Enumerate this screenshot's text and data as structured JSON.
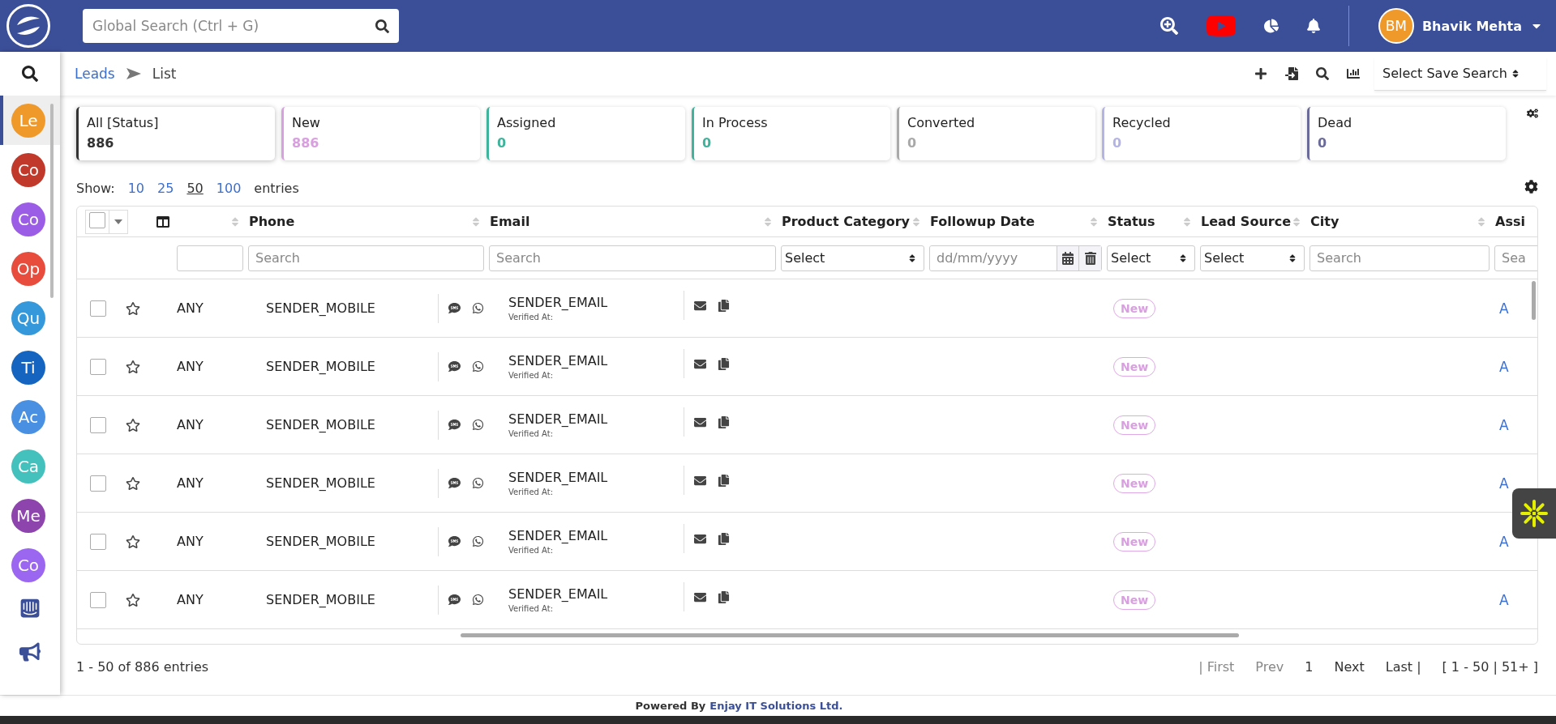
{
  "topbar": {
    "search_placeholder": "Global Search (Ctrl + G)",
    "user": {
      "initials": "BM",
      "name": "Bhavik Mehta"
    }
  },
  "sidebar": {
    "items": [
      {
        "label": "Le",
        "color": "#f0992b",
        "selected": true
      },
      {
        "label": "Co",
        "color": "#c0392b",
        "selected": false
      },
      {
        "label": "Co",
        "color": "#9b5de5",
        "selected": false
      },
      {
        "label": "Op",
        "color": "#e74c3c",
        "selected": false
      },
      {
        "label": "Qu",
        "color": "#3498db",
        "selected": false
      },
      {
        "label": "Ti",
        "color": "#1565c0",
        "selected": false
      },
      {
        "label": "Ac",
        "color": "#4a90e2",
        "selected": false
      },
      {
        "label": "Ca",
        "color": "#45c1bd",
        "selected": false
      },
      {
        "label": "Me",
        "color": "#8e44ad",
        "selected": false
      },
      {
        "label": "Co",
        "color": "#9b66f0",
        "selected": false
      }
    ]
  },
  "breadcrumb": [
    "Leads",
    "List"
  ],
  "save_search": "Select Save Search",
  "status_cards": [
    {
      "label": "All [Status]",
      "count": "886",
      "color": "#333333",
      "selected": true
    },
    {
      "label": "New",
      "count": "886",
      "color": "#d9a0e0",
      "selected": false
    },
    {
      "label": "Assigned",
      "count": "0",
      "color": "#3fb39b",
      "selected": false
    },
    {
      "label": "In Process",
      "count": "0",
      "color": "#3fb39b",
      "selected": false
    },
    {
      "label": "Converted",
      "count": "0",
      "color": "#a9a9a9",
      "selected": false
    },
    {
      "label": "Recycled",
      "count": "0",
      "color": "#b3b3e6",
      "selected": false
    },
    {
      "label": "Dead",
      "count": "0",
      "color": "#6b6b99",
      "selected": false
    }
  ],
  "show": {
    "label": "Show:",
    "options": [
      {
        "label": "10",
        "selected": false
      },
      {
        "label": "25",
        "selected": false
      },
      {
        "label": "50",
        "selected": true
      },
      {
        "label": "100",
        "selected": false
      }
    ],
    "suffix": "entries"
  },
  "table": {
    "select_all": {
      "checked": false
    },
    "columns": [
      {
        "filter": {
          "kind": "text"
        }
      },
      {
        "label": "Phone",
        "filter": {
          "kind": "text",
          "placeholder": "Search"
        }
      },
      {
        "label": "Email",
        "filter": {
          "kind": "text",
          "placeholder": "Search"
        }
      },
      {
        "label": "Product Category",
        "filter": {
          "kind": "select",
          "value": "Select"
        }
      },
      {
        "label": "Followup Date",
        "filter": {
          "kind": "date",
          "placeholder": "dd/mm/yyyy"
        }
      },
      {
        "label": "Status",
        "filter": {
          "kind": "select",
          "value": "Select"
        }
      },
      {
        "label": "Lead Source",
        "filter": {
          "kind": "select",
          "value": "Select"
        }
      },
      {
        "label": "City",
        "filter": {
          "kind": "text",
          "placeholder": "Search"
        }
      },
      {
        "label": "Assi",
        "filter": {
          "kind": "text",
          "placeholder": "Sea"
        }
      }
    ],
    "rows": [
      {
        "checked": false,
        "starred": false,
        "column_2": "ANY",
        "phone": "SENDER_MOBILE",
        "email": "SENDER_EMAIL",
        "verified": "Verified At:",
        "status": "New",
        "assigned": "A"
      },
      {
        "checked": false,
        "starred": false,
        "column_2": "ANY",
        "phone": "SENDER_MOBILE",
        "email": "SENDER_EMAIL",
        "verified": "Verified At:",
        "status": "New",
        "assigned": "A"
      },
      {
        "checked": false,
        "starred": false,
        "column_2": "ANY",
        "phone": "SENDER_MOBILE",
        "email": "SENDER_EMAIL",
        "verified": "Verified At:",
        "status": "New",
        "assigned": "A"
      },
      {
        "checked": false,
        "starred": false,
        "column_2": "ANY",
        "phone": "SENDER_MOBILE",
        "email": "SENDER_EMAIL",
        "verified": "Verified At:",
        "status": "New",
        "assigned": "A"
      },
      {
        "checked": false,
        "starred": false,
        "column_2": "ANY",
        "phone": "SENDER_MOBILE",
        "email": "SENDER_EMAIL",
        "verified": "Verified At:",
        "status": "New",
        "assigned": "A"
      },
      {
        "checked": false,
        "starred": false,
        "column_2": "ANY",
        "phone": "SENDER_MOBILE",
        "email": "SENDER_EMAIL",
        "verified": "Verified At:",
        "status": "New",
        "assigned": "A"
      }
    ]
  },
  "pagination": {
    "summary": "1 - 50 of 886 entries",
    "links": [
      "| First",
      "Prev",
      "1",
      "Next",
      "Last |"
    ],
    "range": "[ 1 - 50 | 51+ ]"
  },
  "footer": {
    "prefix": "Powered By",
    "company": "Enjay IT Solutions Ltd."
  }
}
